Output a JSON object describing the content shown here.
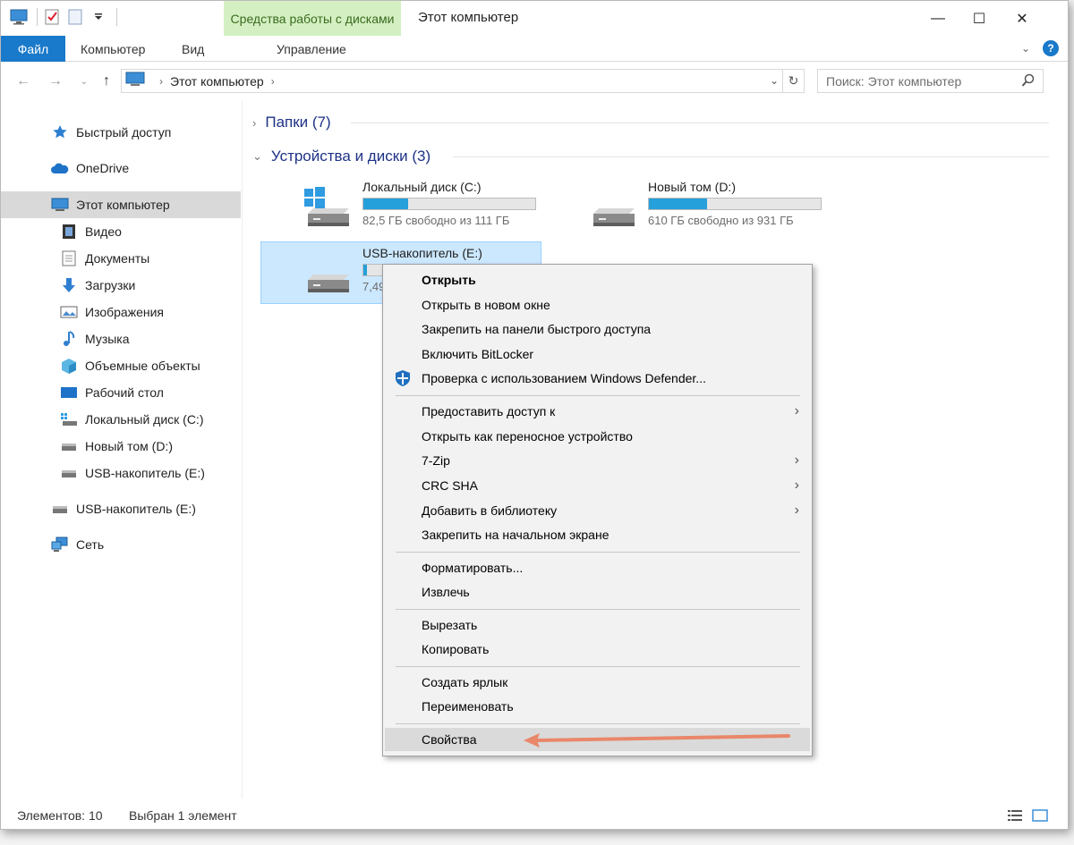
{
  "window": {
    "contextual_tab": "Средства работы с дисками",
    "title": "Этот компьютер",
    "minimize": "—",
    "maximize": "☐",
    "close": "✕"
  },
  "ribbon": {
    "file": "Файл",
    "computer": "Компьютер",
    "view": "Вид",
    "manage": "Управление"
  },
  "address": {
    "breadcrumb": "Этот компьютер",
    "search_placeholder": "Поиск: Этот компьютер"
  },
  "sidebar": {
    "items": [
      {
        "label": "Быстрый доступ",
        "icon": "star-icon"
      },
      {
        "label": "OneDrive",
        "icon": "cloud-icon"
      },
      {
        "label": "Этот компьютер",
        "icon": "computer-icon"
      },
      {
        "label": "Видео",
        "icon": "video-icon"
      },
      {
        "label": "Документы",
        "icon": "document-icon"
      },
      {
        "label": "Загрузки",
        "icon": "download-icon"
      },
      {
        "label": "Изображения",
        "icon": "picture-icon"
      },
      {
        "label": "Музыка",
        "icon": "music-icon"
      },
      {
        "label": "Объемные объекты",
        "icon": "cube-icon"
      },
      {
        "label": "Рабочий стол",
        "icon": "desktop-icon"
      },
      {
        "label": "Локальный диск (C:)",
        "icon": "system-drive-icon"
      },
      {
        "label": "Новый том (D:)",
        "icon": "drive-icon"
      },
      {
        "label": "USB-накопитель (E:)",
        "icon": "usb-drive-icon"
      },
      {
        "label": "USB-накопитель (E:)",
        "icon": "usb-drive-icon"
      },
      {
        "label": "Сеть",
        "icon": "network-icon"
      }
    ]
  },
  "content": {
    "folders_header": "Папки (7)",
    "devices_header": "Устройства и диски (3)",
    "drives": [
      {
        "name": "Локальный диск (C:)",
        "info": "82,5 ГБ свободно из 111 ГБ",
        "used_fraction": 0.26
      },
      {
        "name": "Новый том (D:)",
        "info": "610 ГБ свободно из 931 ГБ",
        "used_fraction": 0.34
      },
      {
        "name": "USB-накопитель (E:)",
        "info": "7,49",
        "used_fraction": 0.02
      }
    ]
  },
  "context_menu": {
    "items": [
      "Открыть",
      "Открыть в новом окне",
      "Закрепить на панели быстрого доступа",
      "Включить BitLocker",
      "Проверка с использованием Windows Defender...",
      "Предоставить доступ к",
      "Открыть как переносное устройство",
      "7-Zip",
      "CRC SHA",
      "Добавить в библиотеку",
      "Закрепить на начальном экране",
      "Форматировать...",
      "Извлечь",
      "Вырезать",
      "Копировать",
      "Создать ярлык",
      "Переименовать",
      "Свойства"
    ]
  },
  "status": {
    "count": "Элементов: 10",
    "selected": "Выбран 1 элемент"
  },
  "colors": {
    "accent": "#1979ca",
    "contextual": "#d4f0c2",
    "drive_bar": "#26a0da",
    "annotation_arrow": "#e9876a"
  }
}
